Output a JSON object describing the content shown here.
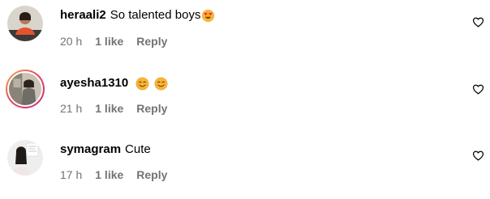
{
  "comments": [
    {
      "username": "heraali2",
      "text": "So talented boys",
      "emojis": [
        "heart-eyes-emoji"
      ],
      "time": "20 h",
      "likes": "1 like",
      "reply": "Reply",
      "avatar": "avatar-photo-heraali2",
      "like_icon": "heart-outline-icon",
      "story_ring": false
    },
    {
      "username": "ayesha1310",
      "text": "",
      "emojis": [
        "smiling-face-emoji",
        "smiling-face-emoji"
      ],
      "time": "21 h",
      "likes": "1 like",
      "reply": "Reply",
      "avatar": "avatar-photo-ayesha1310",
      "like_icon": "heart-outline-icon",
      "story_ring": true
    },
    {
      "username": "symagram",
      "text": "Cute",
      "emojis": [],
      "time": "17 h",
      "likes": "1 like",
      "reply": "Reply",
      "avatar": "avatar-photo-symagram",
      "like_icon": "heart-outline-icon",
      "story_ring": false
    }
  ],
  "colors": {
    "text": "#000000",
    "meta": "#737373",
    "story_ring_start": "#f5b04a",
    "story_ring_end": "#c13584",
    "emoji_yellow": "#f7b731"
  }
}
